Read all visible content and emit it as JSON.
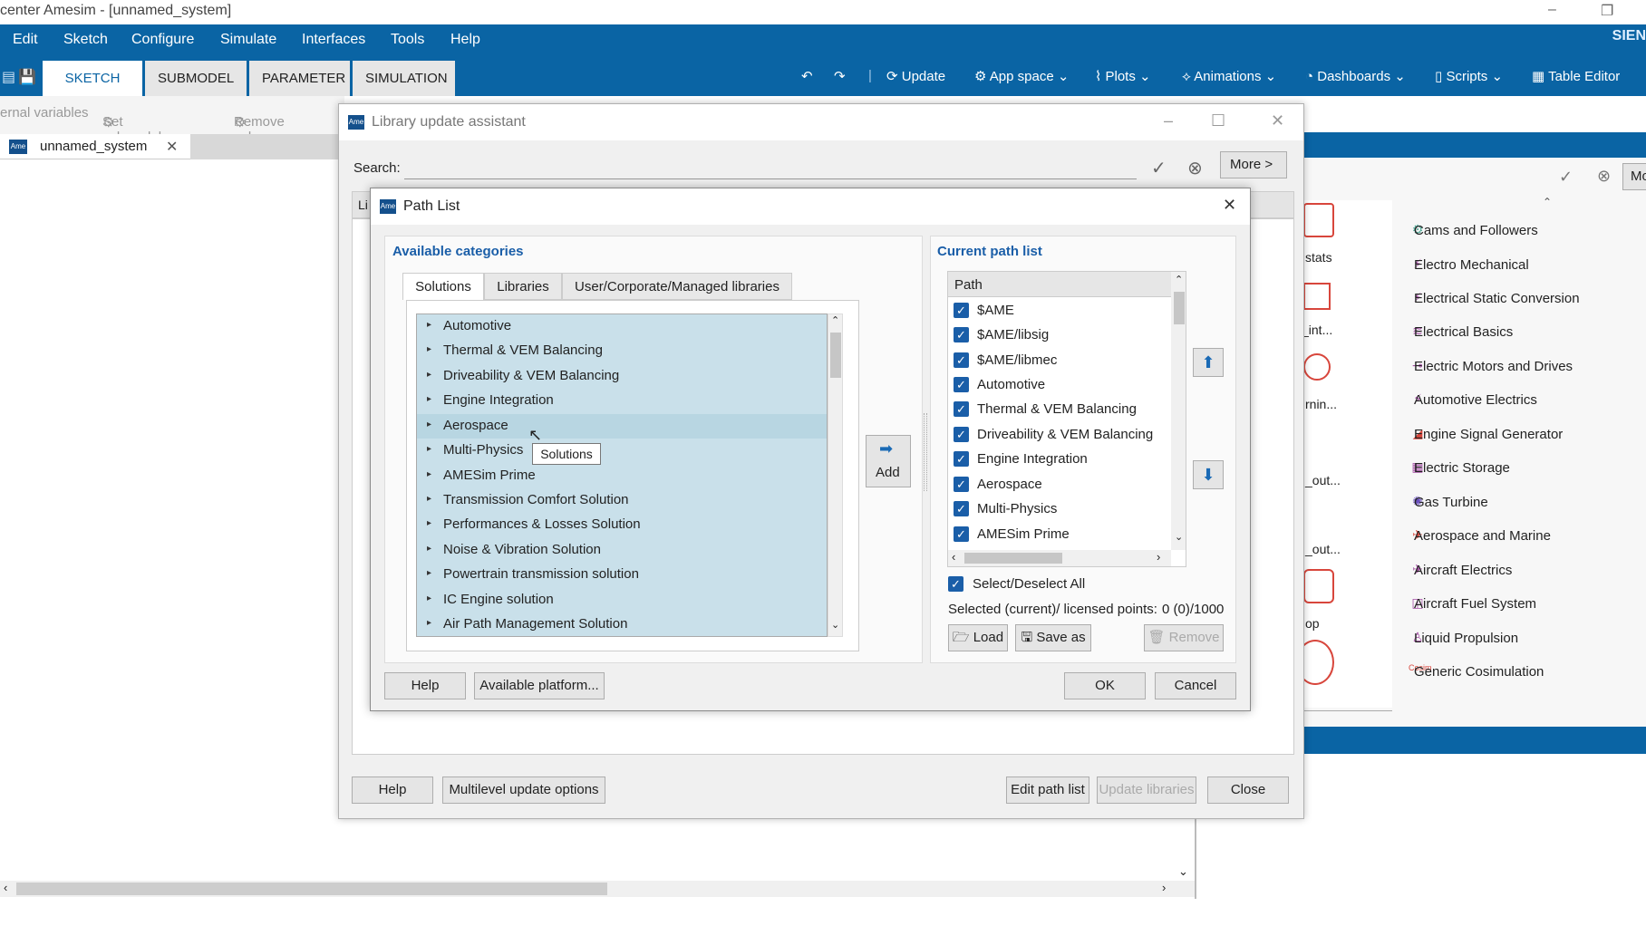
{
  "window": {
    "title": "center Amesim - [unnamed_system]",
    "min": "–",
    "restore": "❐"
  },
  "menu": [
    "Edit",
    "Sketch",
    "Configure",
    "Simulate",
    "Interfaces",
    "Tools",
    "Help"
  ],
  "brand": "SIEN",
  "ribbon_tabs": [
    "SKETCH",
    "SUBMODEL",
    "PARAMETER",
    "SIMULATION"
  ],
  "ribbon_tools": {
    "update": "Update",
    "app_space": "App space",
    "plots": "Plots",
    "animations": "Animations",
    "dashboards": "Dashboards",
    "scripts": "Scripts",
    "table_editor": "Table Editor"
  },
  "toolrow": {
    "internal_vars": "ernal variables",
    "set_submodels": "Set submodels",
    "remove_submodels": "Remove subm"
  },
  "doc_tab": "unnamed_system",
  "right_panel": {
    "more": "Mo",
    "items": [
      "Cams and Followers",
      "Electro Mechanical",
      "Electrical Static Conversion",
      "Electrical Basics",
      "Electric Motors and Drives",
      "Automotive Electrics",
      "Engine Signal Generator",
      "Electric Storage",
      "Gas Turbine",
      "Aerospace and Marine",
      "Aircraft Electrics",
      "Aircraft Fuel System",
      "Liquid Propulsion",
      "Generic Cosimulation"
    ],
    "partial_labels": [
      "stats",
      "_int...",
      "rnin...",
      "_out...",
      "_out...",
      "op"
    ]
  },
  "lua": {
    "title": "Library update assistant",
    "app_icon": "Ame",
    "search_label": "Search:",
    "more_button": "More >",
    "tab_stub": "Li",
    "help": "Help",
    "multilevel": "Multilevel update options",
    "edit_path": "Edit path list",
    "update_libs": "Update libraries",
    "close": "Close"
  },
  "path_dialog": {
    "title": "Path List",
    "available_title": "Available categories",
    "current_title": "Current path list",
    "tabs": [
      "Solutions",
      "Libraries",
      "User/Corporate/Managed libraries"
    ],
    "categories": [
      "Automotive",
      "Thermal & VEM Balancing",
      "Driveability & VEM Balancing",
      "Engine Integration",
      "Aerospace",
      "Multi-Physics",
      "AMESim Prime",
      "Transmission Comfort Solution",
      "Performances & Losses Solution",
      "Noise & Vibration Solution",
      "Powertrain transmission solution",
      "IC Engine solution",
      "Air Path Management Solution"
    ],
    "tooltip": "Solutions",
    "add_label": "Add",
    "path_header": "Path",
    "paths": [
      "$AME",
      "$AME/libsig",
      "$AME/libmec",
      "Automotive",
      "Thermal & VEM Balancing",
      "Driveability & VEM Balancing",
      "Engine Integration",
      "Aerospace",
      "Multi-Physics",
      "AMESim Prime"
    ],
    "select_all": "Select/Deselect All",
    "points_label": "Selected (current)/ licensed points:",
    "points_value": "0 (0)/1000",
    "load": "Load",
    "save_as": "Save as",
    "remove": "Remove",
    "help": "Help",
    "available_platform": "Available platform...",
    "ok": "OK",
    "cancel": "Cancel"
  }
}
